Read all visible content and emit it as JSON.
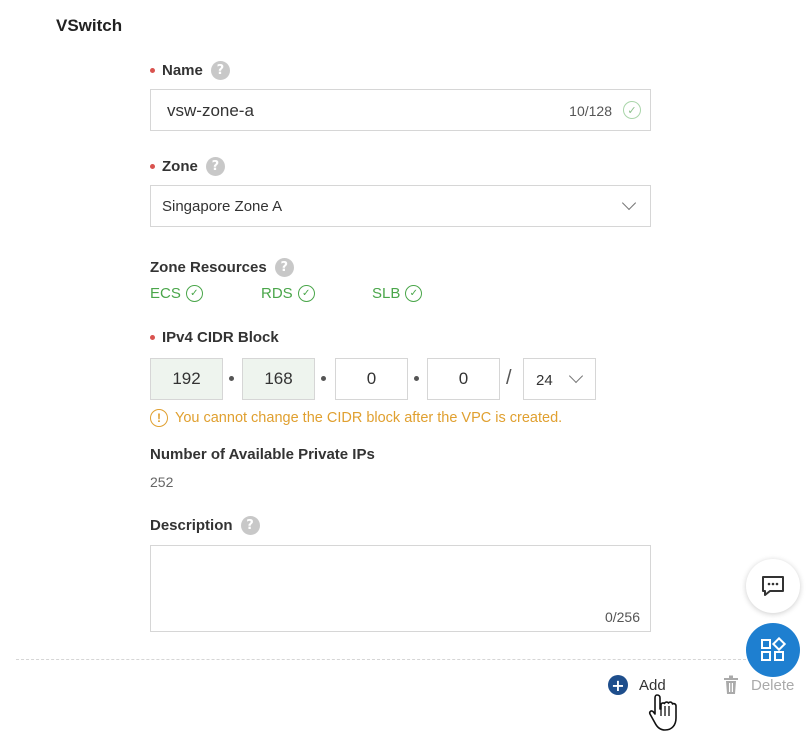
{
  "section": {
    "title": "VSwitch"
  },
  "name": {
    "label": "Name",
    "value": "vsw-zone-a",
    "counter": "10/128"
  },
  "zone": {
    "label": "Zone",
    "selected": "Singapore Zone A"
  },
  "zone_resources": {
    "label": "Zone Resources",
    "items": [
      {
        "name": "ECS",
        "status": "available"
      },
      {
        "name": "RDS",
        "status": "available"
      },
      {
        "name": "SLB",
        "status": "available"
      }
    ]
  },
  "cidr": {
    "label": "IPv4 CIDR Block",
    "octets": [
      "192",
      "168",
      "0",
      "0"
    ],
    "mask": "24",
    "warning": "You cannot change the CIDR block after the VPC is created."
  },
  "private_ips": {
    "label": "Number of Available Private IPs",
    "value": "252"
  },
  "description": {
    "label": "Description",
    "value": "",
    "counter": "0/256"
  },
  "actions": {
    "add_label": "Add",
    "delete_label": "Delete"
  },
  "colors": {
    "required": "#d9534f",
    "success": "#4aa64a",
    "warning": "#e0a030",
    "primary": "#1e7fd0",
    "add_icon": "#1e4e8c"
  },
  "icons": [
    "help-icon",
    "check-circle-icon",
    "chevron-down-icon",
    "warning-icon",
    "plus-circle-icon",
    "trash-icon",
    "chat-icon",
    "apps-icon",
    "hand-cursor-icon"
  ]
}
